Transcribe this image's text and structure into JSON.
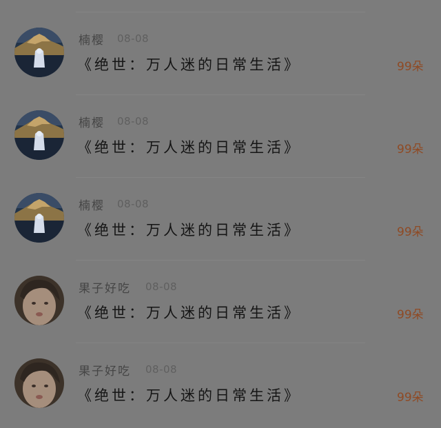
{
  "items": [
    {
      "user": "楠樱",
      "date": "08-08",
      "avatar": "mountain-avatar",
      "title": "《绝世：万人迷的日常生活》",
      "amount": "99朵"
    },
    {
      "user": "楠樱",
      "date": "08-08",
      "avatar": "mountain-avatar",
      "title": "《绝世：万人迷的日常生活》",
      "amount": "99朵"
    },
    {
      "user": "楠樱",
      "date": "08-08",
      "avatar": "mountain-avatar",
      "title": "《绝世：万人迷的日常生活》",
      "amount": "99朵"
    },
    {
      "user": "果子好吃",
      "date": "08-08",
      "avatar": "portrait-avatar",
      "title": "《绝世：万人迷的日常生活》",
      "amount": "99朵"
    },
    {
      "user": "果子好吃",
      "date": "08-08",
      "avatar": "portrait-avatar",
      "title": "《绝世：万人迷的日常生活》",
      "amount": "99朵"
    }
  ]
}
